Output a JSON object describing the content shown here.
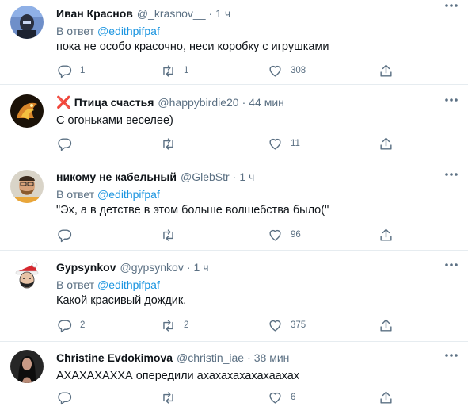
{
  "tweets": [
    {
      "name": "Иван Краснов",
      "handle": "@_krasnov__",
      "dot": "·",
      "time": "1 ч",
      "reply_prefix": "В ответ",
      "reply_to": "@edithpifpaf",
      "text": "пока не особо красочно, неси коробку с игрушками",
      "replies": "1",
      "retweets": "1",
      "likes": "308"
    },
    {
      "badge": "❌",
      "name": "Птица счастья",
      "handle": "@happybirdie20",
      "dot": "·",
      "time": "44 мин",
      "text": "С огоньками веселее)",
      "replies": "",
      "retweets": "",
      "likes": "11"
    },
    {
      "name": "никому не кабельный",
      "handle": "@GlebStr",
      "dot": "·",
      "time": "1 ч",
      "reply_prefix": "В ответ",
      "reply_to": "@edithpifpaf",
      "text": "\"Эх, а в детстве в этом больше волшебства было(\"",
      "replies": "",
      "retweets": "",
      "likes": "96"
    },
    {
      "name": "Gypsynkov",
      "handle": "@gypsynkov",
      "dot": "·",
      "time": "1 ч",
      "reply_prefix": "В ответ",
      "reply_to": "@edithpifpaf",
      "text": "Какой красивый дождик.",
      "replies": "2",
      "retweets": "2",
      "likes": "375"
    },
    {
      "name": "Christine Evdokimova",
      "handle": "@christin_iae",
      "dot": "·",
      "time": "38 мин",
      "text": "АХАХАХАХХА опередили ахахахахахахаахах",
      "replies": "",
      "retweets": "",
      "likes": "6"
    }
  ],
  "icons": {
    "reply": "reply-icon",
    "retweet": "retweet-icon",
    "like": "heart-icon",
    "share": "share-icon",
    "more": "more-options-icon"
  },
  "colors": {
    "text": "#0f1419",
    "secondary": "#5b7083",
    "mention": "#1b95e0",
    "divider": "#e6ecf0",
    "badge": "#e0245e"
  }
}
